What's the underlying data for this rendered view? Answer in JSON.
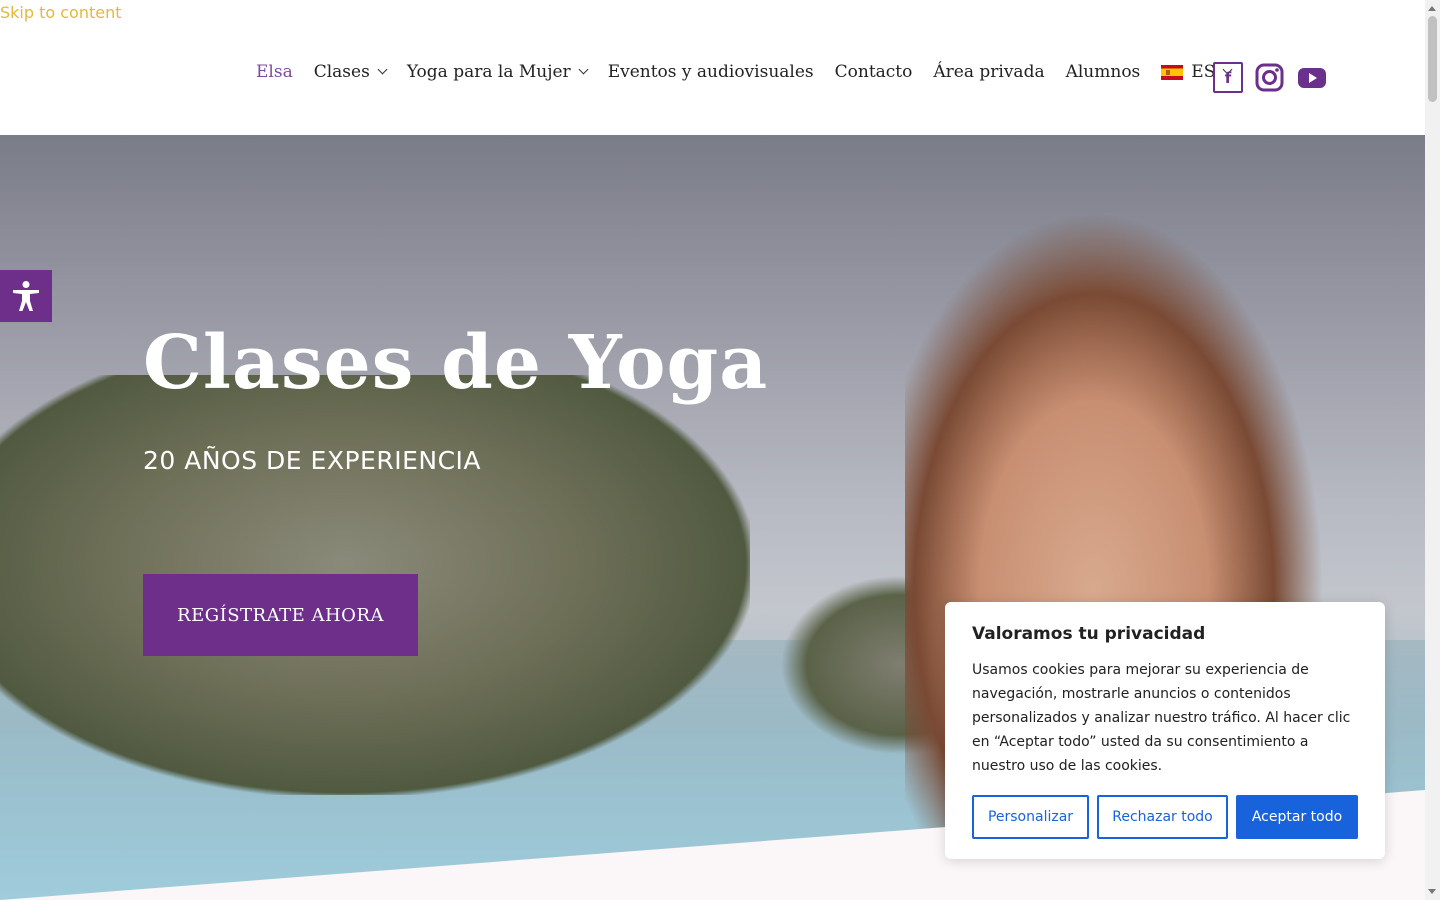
{
  "skip_link": "Skip to content",
  "nav": {
    "items": [
      {
        "label": "Elsa",
        "dropdown": false,
        "active": true
      },
      {
        "label": "Clases",
        "dropdown": true
      },
      {
        "label": "Yoga para la Mujer",
        "dropdown": true
      },
      {
        "label": "Eventos y audiovisuales",
        "dropdown": false
      },
      {
        "label": "Contacto",
        "dropdown": false
      },
      {
        "label": "Área privada",
        "dropdown": false
      },
      {
        "label": "Alumnos",
        "dropdown": false
      }
    ],
    "language": "ES",
    "accent_color": "#7d4a9e"
  },
  "social": {
    "facebook_glyph": "f",
    "icons": [
      "facebook-icon",
      "instagram-icon",
      "youtube-icon"
    ],
    "color": "#6b2f8c"
  },
  "hero": {
    "title": "Clases de Yoga",
    "subtitle": "20 AÑOS DE EXPERIENCIA",
    "button": "REGÍSTRATE AHORA",
    "button_color": "#6e2f8b"
  },
  "accessibility": {
    "icon": "accessibility-icon"
  },
  "cookie": {
    "title": "Valoramos tu privacidad",
    "text": "Usamos cookies para mejorar su experiencia de navegación, mostrarle anuncios o contenidos personalizados y analizar nuestro tráfico. Al hacer clic en “Aceptar todo” usted da su consentimiento a nuestro uso de las cookies.",
    "buttons": {
      "customize": "Personalizar",
      "reject": "Rechazar todo",
      "accept": "Aceptar todo"
    },
    "button_color": "#1863dc"
  }
}
